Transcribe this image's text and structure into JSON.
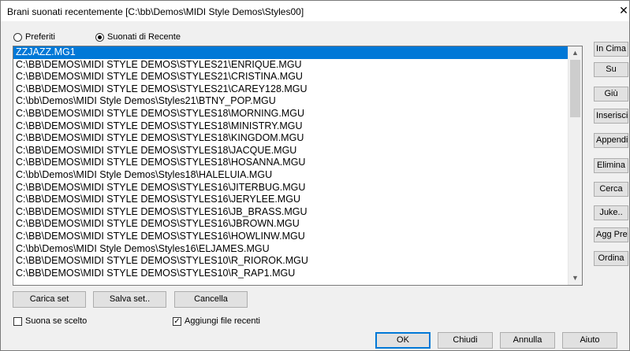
{
  "window": {
    "title": "Brani suonati recentemente   [C:\\bb\\Demos\\MIDI Style Demos\\Styles00]",
    "close_glyph": "✕"
  },
  "filter": {
    "favorites_label": "Preferiti",
    "recent_label": "Suonati di Recente",
    "selected": "recent"
  },
  "list": {
    "items": [
      "ZZJAZZ.MG1",
      "C:\\BB\\DEMOS\\MIDI STYLE DEMOS\\STYLES21\\ENRIQUE.MGU",
      "C:\\BB\\DEMOS\\MIDI STYLE DEMOS\\STYLES21\\CRISTINA.MGU",
      "C:\\BB\\DEMOS\\MIDI STYLE DEMOS\\STYLES21\\CAREY128.MGU",
      "C:\\bb\\Demos\\MIDI Style Demos\\Styles21\\BTNY_POP.MGU",
      "C:\\BB\\DEMOS\\MIDI STYLE DEMOS\\STYLES18\\MORNING.MGU",
      "C:\\BB\\DEMOS\\MIDI STYLE DEMOS\\STYLES18\\MINISTRY.MGU",
      "C:\\BB\\DEMOS\\MIDI STYLE DEMOS\\STYLES18\\KINGDOM.MGU",
      "C:\\BB\\DEMOS\\MIDI STYLE DEMOS\\STYLES18\\JACQUE.MGU",
      "C:\\BB\\DEMOS\\MIDI STYLE DEMOS\\STYLES18\\HOSANNA.MGU",
      "C:\\bb\\Demos\\MIDI Style Demos\\Styles18\\HALELUIA.MGU",
      "C:\\BB\\DEMOS\\MIDI STYLE DEMOS\\STYLES16\\JITERBUG.MGU",
      "C:\\BB\\DEMOS\\MIDI STYLE DEMOS\\STYLES16\\JERYLEE.MGU",
      "C:\\BB\\DEMOS\\MIDI STYLE DEMOS\\STYLES16\\JB_BRASS.MGU",
      "C:\\BB\\DEMOS\\MIDI STYLE DEMOS\\STYLES16\\JBROWN.MGU",
      "C:\\BB\\DEMOS\\MIDI STYLE DEMOS\\STYLES16\\HOWLINW.MGU",
      "C:\\bb\\Demos\\MIDI Style Demos\\Styles16\\ELJAMES.MGU",
      "C:\\BB\\DEMOS\\MIDI STYLE DEMOS\\STYLES10\\R_RIOROK.MGU",
      "C:\\BB\\DEMOS\\MIDI STYLE DEMOS\\STYLES10\\R_RAP1.MGU"
    ],
    "selected_index": 0,
    "scroll_up_glyph": "▲",
    "scroll_down_glyph": "▼"
  },
  "side_buttons": [
    "In Cima",
    "Su",
    "Giù",
    "Inserisci",
    "Appendi",
    "Elimina",
    "Cerca",
    "Juke..",
    "Agg Pref",
    "Ordina"
  ],
  "set_buttons": {
    "load": "Carica set",
    "save": "Salva set..",
    "delete": "Cancella"
  },
  "options": {
    "play_on_select_label": "Suona se scelto",
    "play_on_select_checked": false,
    "add_recent_label": "Aggiungi file recenti",
    "add_recent_checked": true,
    "check_glyph": "✓"
  },
  "dialog_buttons": {
    "ok": "OK",
    "close": "Chiudi",
    "cancel": "Annulla",
    "help": "Aiuto"
  }
}
